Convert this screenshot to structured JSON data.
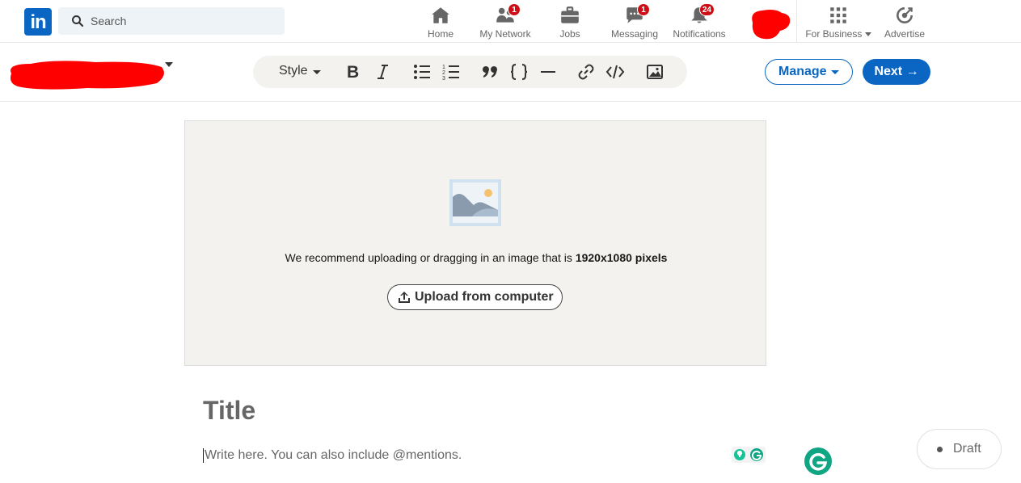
{
  "nav": {
    "logo": "in",
    "search_placeholder": "Search",
    "items": [
      {
        "label": "Home",
        "badge": ""
      },
      {
        "label": "My Network",
        "badge": "1"
      },
      {
        "label": "Jobs",
        "badge": ""
      },
      {
        "label": "Messaging",
        "badge": "1"
      },
      {
        "label": "Notifications",
        "badge": "24"
      },
      {
        "label": "For Business",
        "badge": ""
      },
      {
        "label": "Advertise",
        "badge": ""
      }
    ]
  },
  "editor": {
    "style_label": "Style",
    "manage_label": "Manage",
    "next_label": "Next →"
  },
  "cover": {
    "hint_text": "We recommend uploading or dragging in an image that is ",
    "hint_bold": "1920x1080 pixels",
    "upload_label": "Upload from computer"
  },
  "article": {
    "title_placeholder": "Title",
    "body_placeholder": "Write here. You can also include @mentions."
  },
  "status": {
    "draft_label": "Draft"
  },
  "colors": {
    "brand": "#0a66c2",
    "badge": "#cc1016",
    "redaction": "#ff0000"
  }
}
